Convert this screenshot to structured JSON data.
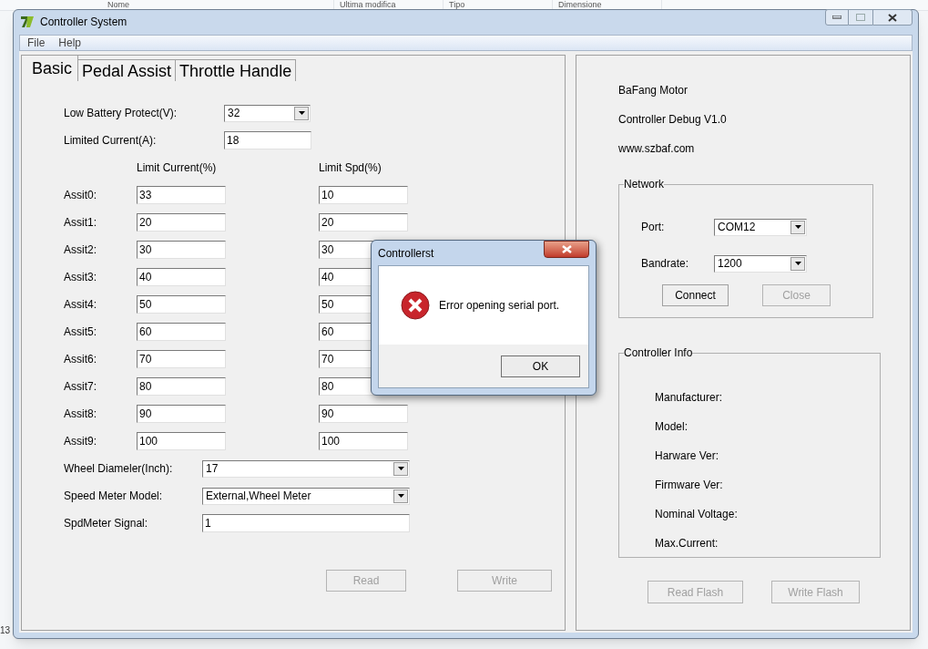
{
  "background": {
    "columns": [
      "Nome",
      "Ultima modifica",
      "Tipo",
      "Dimensione"
    ],
    "corner_text": "13"
  },
  "window": {
    "title": "Controller System"
  },
  "menu": [
    "File",
    "Help"
  ],
  "tabs": [
    {
      "label": "Basic",
      "selected": true
    },
    {
      "label": "Pedal Assist",
      "selected": false
    },
    {
      "label": "Throttle Handle",
      "selected": false
    }
  ],
  "basic": {
    "top_fields": [
      {
        "label": "Low Battery Protect(V):",
        "value": "32",
        "kind": "combo"
      },
      {
        "label": "Limited Current(A):",
        "value": "18",
        "kind": "text"
      }
    ],
    "columns": [
      "Limit Current(%)",
      "Limit Spd(%)"
    ],
    "assists": [
      {
        "label": "Assit0:",
        "current": "33",
        "speed": "10"
      },
      {
        "label": "Assit1:",
        "current": "20",
        "speed": "20"
      },
      {
        "label": "Assit2:",
        "current": "30",
        "speed": "30"
      },
      {
        "label": "Assit3:",
        "current": "40",
        "speed": "40"
      },
      {
        "label": "Assit4:",
        "current": "50",
        "speed": "50"
      },
      {
        "label": "Assit5:",
        "current": "60",
        "speed": "60"
      },
      {
        "label": "Assit6:",
        "current": "70",
        "speed": "70"
      },
      {
        "label": "Assit7:",
        "current": "80",
        "speed": "80"
      },
      {
        "label": "Assit8:",
        "current": "90",
        "speed": "90"
      },
      {
        "label": "Assit9:",
        "current": "100",
        "speed": "100"
      }
    ],
    "bottom_fields": [
      {
        "label": "Wheel Diameler(Inch):",
        "value": "17",
        "kind": "combo"
      },
      {
        "label": "Speed Meter Model:",
        "value": "External,Wheel Meter",
        "kind": "combo"
      },
      {
        "label": "SpdMeter Signal:",
        "value": "1",
        "kind": "text"
      }
    ],
    "buttons": [
      {
        "label": "Read",
        "disabled": true
      },
      {
        "label": "Write",
        "disabled": true
      }
    ]
  },
  "about": [
    "BaFang Motor",
    "Controller Debug V1.0",
    "www.szbaf.com"
  ],
  "network": {
    "title": "Network",
    "fields": [
      {
        "label": "Port:",
        "value": "COM12",
        "kind": "combo"
      },
      {
        "label": "Bandrate:",
        "value": "1200",
        "kind": "combo"
      }
    ],
    "buttons": [
      {
        "label": "Connect",
        "disabled": false
      },
      {
        "label": "Close",
        "disabled": true
      }
    ]
  },
  "controller_info": {
    "title": "Controller Info",
    "fields": [
      "Manufacturer:",
      "Model:",
      "Harware Ver:",
      "Firmware Ver:",
      "Nominal Voltage:",
      "Max.Current:"
    ]
  },
  "flash_buttons": [
    {
      "label": "Read Flash",
      "disabled": true
    },
    {
      "label": "Write Flash",
      "disabled": true
    }
  ],
  "dialog": {
    "title": "Controllerst",
    "message": "Error opening serial port.",
    "button": "OK"
  }
}
